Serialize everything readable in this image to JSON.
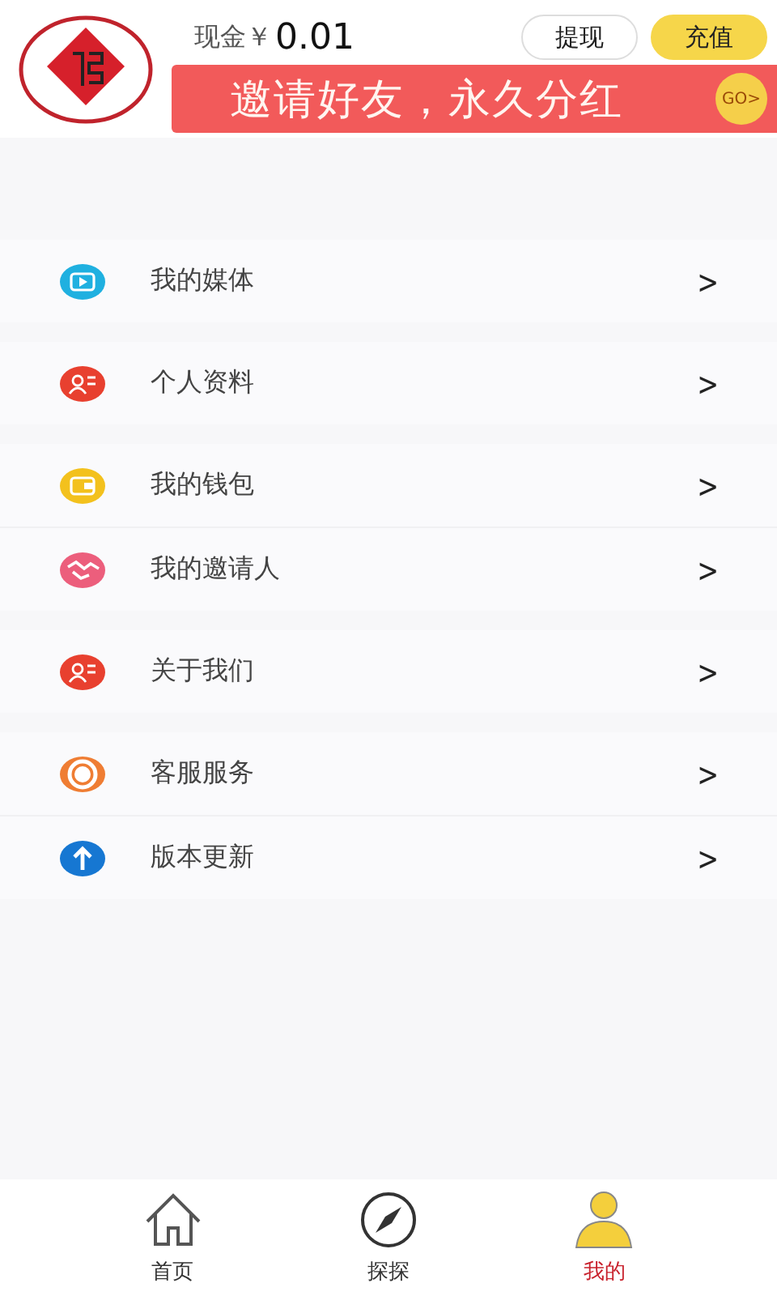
{
  "header": {
    "balance_label": "现金￥",
    "balance": "0.01",
    "buttons": [
      {
        "label": "提现",
        "kind": "outline"
      },
      {
        "label": "充值",
        "kind": "primary"
      }
    ],
    "banner": {
      "text": "邀请好友，永久分红",
      "go": "GO>"
    }
  },
  "menu_groups": [
    {
      "items": [
        {
          "label": "我的媒体",
          "kind": "media"
        }
      ]
    },
    {
      "items": [
        {
          "label": "个人资料",
          "kind": "profile"
        }
      ]
    },
    {
      "items": [
        {
          "label": "我的钱包",
          "kind": "wallet"
        },
        {
          "label": "我的邀请人",
          "kind": "invite"
        }
      ]
    },
    {
      "items": [
        {
          "label": "关于我们",
          "kind": "profile"
        }
      ]
    },
    {
      "items": [
        {
          "label": "客服服务",
          "kind": "service"
        },
        {
          "label": "版本更新",
          "kind": "update"
        }
      ]
    }
  ],
  "chevron": ">",
  "tab_bar": [
    {
      "label": "首页",
      "kind": "home",
      "selected": false
    },
    {
      "label": "探探",
      "kind": "compass",
      "selected": false
    },
    {
      "label": "我的",
      "kind": "person",
      "selected": true
    }
  ]
}
